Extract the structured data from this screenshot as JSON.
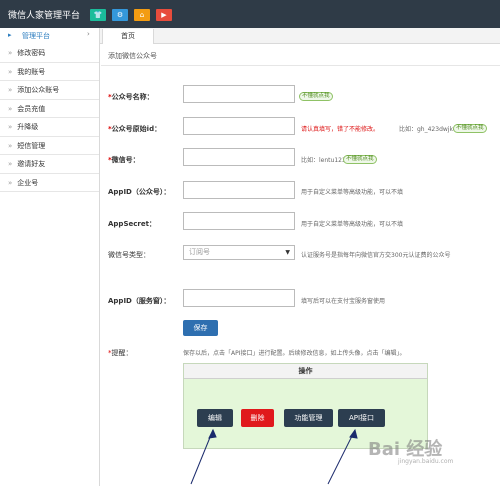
{
  "app": {
    "title": "微信人家管理平台"
  },
  "top_buttons": [
    {
      "icon": "shirt-icon",
      "glyph": "👕",
      "color": "#1bbc9b"
    },
    {
      "icon": "gear-icon",
      "glyph": "⚙",
      "color": "#3498db"
    },
    {
      "icon": "home-icon",
      "glyph": "⌂",
      "color": "#f39c12"
    },
    {
      "icon": "play-icon",
      "glyph": "▶",
      "color": "#e74c3c"
    }
  ],
  "sidebar": {
    "header": "管理平台",
    "items": [
      "修改密码",
      "我的账号",
      "添加公众账号",
      "会员充值",
      "升降级",
      "短信管理",
      "邀请好友",
      "企业号"
    ]
  },
  "tabs": [
    "首页"
  ],
  "page_title": "添加微信公众号",
  "form": {
    "name_label": "公众号名称：",
    "name_badge": "不懂就点我",
    "origin_label": "公众号原始id：",
    "origin_warn": "请认真填写，错了不能修改。",
    "origin_example": "比如：gh_423dwjkeww3",
    "origin_badge": "不懂就点我",
    "wechat_label": "微信号：",
    "wechat_example": "比如：lentu123",
    "wechat_badge": "不懂就点我",
    "appid_label": "AppID（公众号）：",
    "appid_hint": "用于自定义菜单等高级功能，可以不填",
    "secret_label": "AppSecret：",
    "secret_hint": "用于自定义菜单等高级功能，可以不填",
    "type_label": "微信号类型：",
    "type_value": "订阅号",
    "type_hint": "认证服务号是指每年向微信官方交300元认证费的公众号",
    "appid_service_label": "AppID（服务窗）：",
    "appid_service_hint": "填写后可以在支付宝服务窗使用",
    "save_label": "保存",
    "remind_label": "提醒：",
    "remind_text": "保存以后，点击「API接口」进行配置。后续修改信息，如上传头像，点击「编辑」。"
  },
  "ops": {
    "header": "操作",
    "buttons": [
      {
        "label": "编辑",
        "color": "#2c3e50"
      },
      {
        "label": "删除",
        "color": "#e0191c"
      },
      {
        "label": "功能管理",
        "color": "#2c3e50"
      },
      {
        "label": "API接口",
        "color": "#2c3e50"
      }
    ]
  },
  "watermark": {
    "text": "Bai 经验",
    "sub": "jingyan.baidu.com"
  }
}
